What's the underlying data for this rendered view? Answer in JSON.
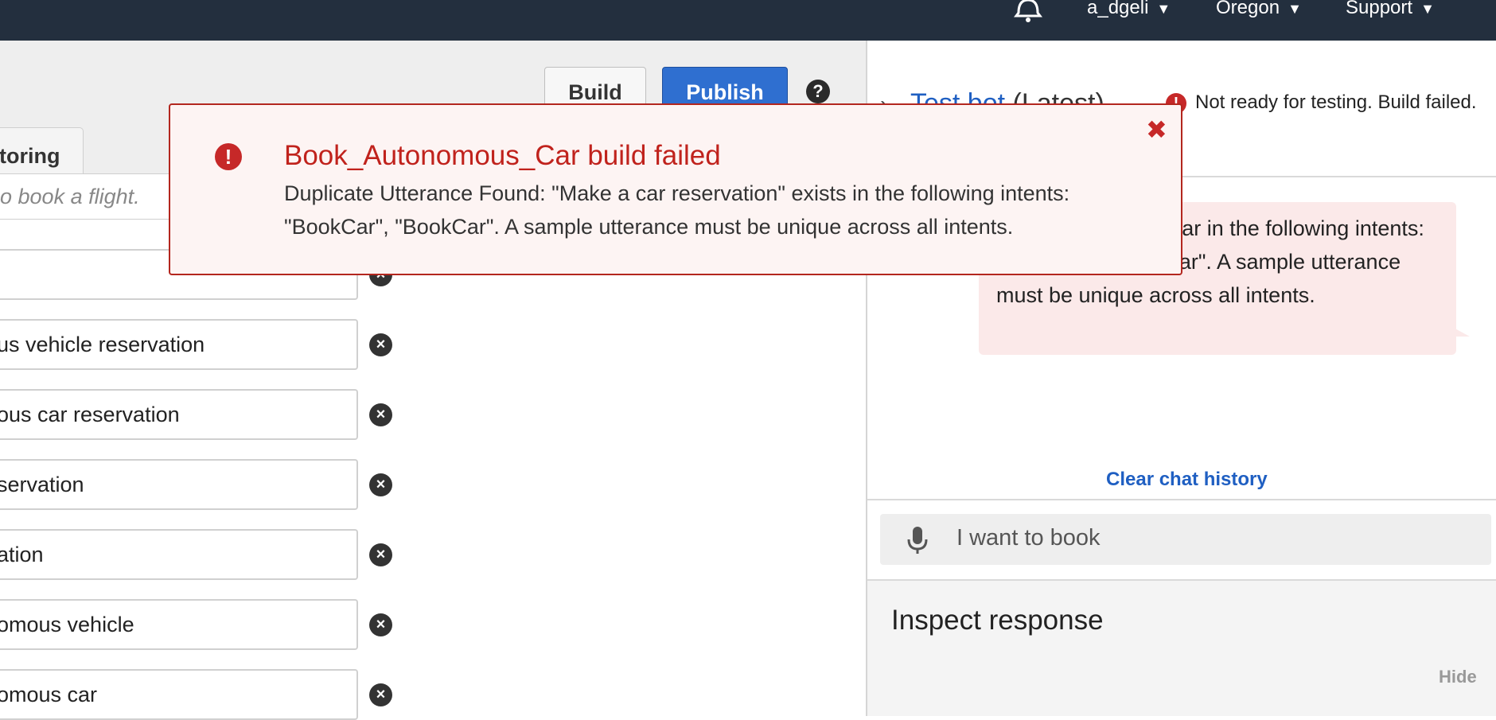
{
  "topbar": {
    "user": "a_dgeli",
    "region": "Oregon",
    "support": "Support",
    "caret": "▼"
  },
  "editor": {
    "build_label": "Build",
    "publish_label": "Publish",
    "help": "?",
    "tab_partial": "toring",
    "utterance_placeholder_partial": "o book a flight.",
    "utterances": [
      "",
      "us vehicle reservation",
      "ous car reservation",
      "servation",
      "ation",
      "omous vehicle",
      "omous car"
    ]
  },
  "test_panel": {
    "title": "Test bot",
    "version": "(Latest)",
    "status": "Not ready for testing. Build failed.",
    "bubble_text": "e Found: \"Make a car                    in the following intents: \"BookCar\", \"BookCar\". A sample utterance must be unique across all intents.",
    "clear_history": "Clear chat history",
    "chat_input_value": "I want to book",
    "inspect_title": "Inspect response",
    "hide_label": "Hide"
  },
  "error_modal": {
    "title": "Book_Autonomous_Car build failed",
    "message": "Duplicate Utterance Found: \"Make a car reservation\" exists in the following intents: \"BookCar\", \"BookCar\". A sample utterance must be unique across all intents.",
    "close": "✖"
  },
  "colors": {
    "topbar": "#232f3e",
    "publish": "#2f6fd0",
    "error": "#c62828",
    "link": "#1f5fc2"
  }
}
